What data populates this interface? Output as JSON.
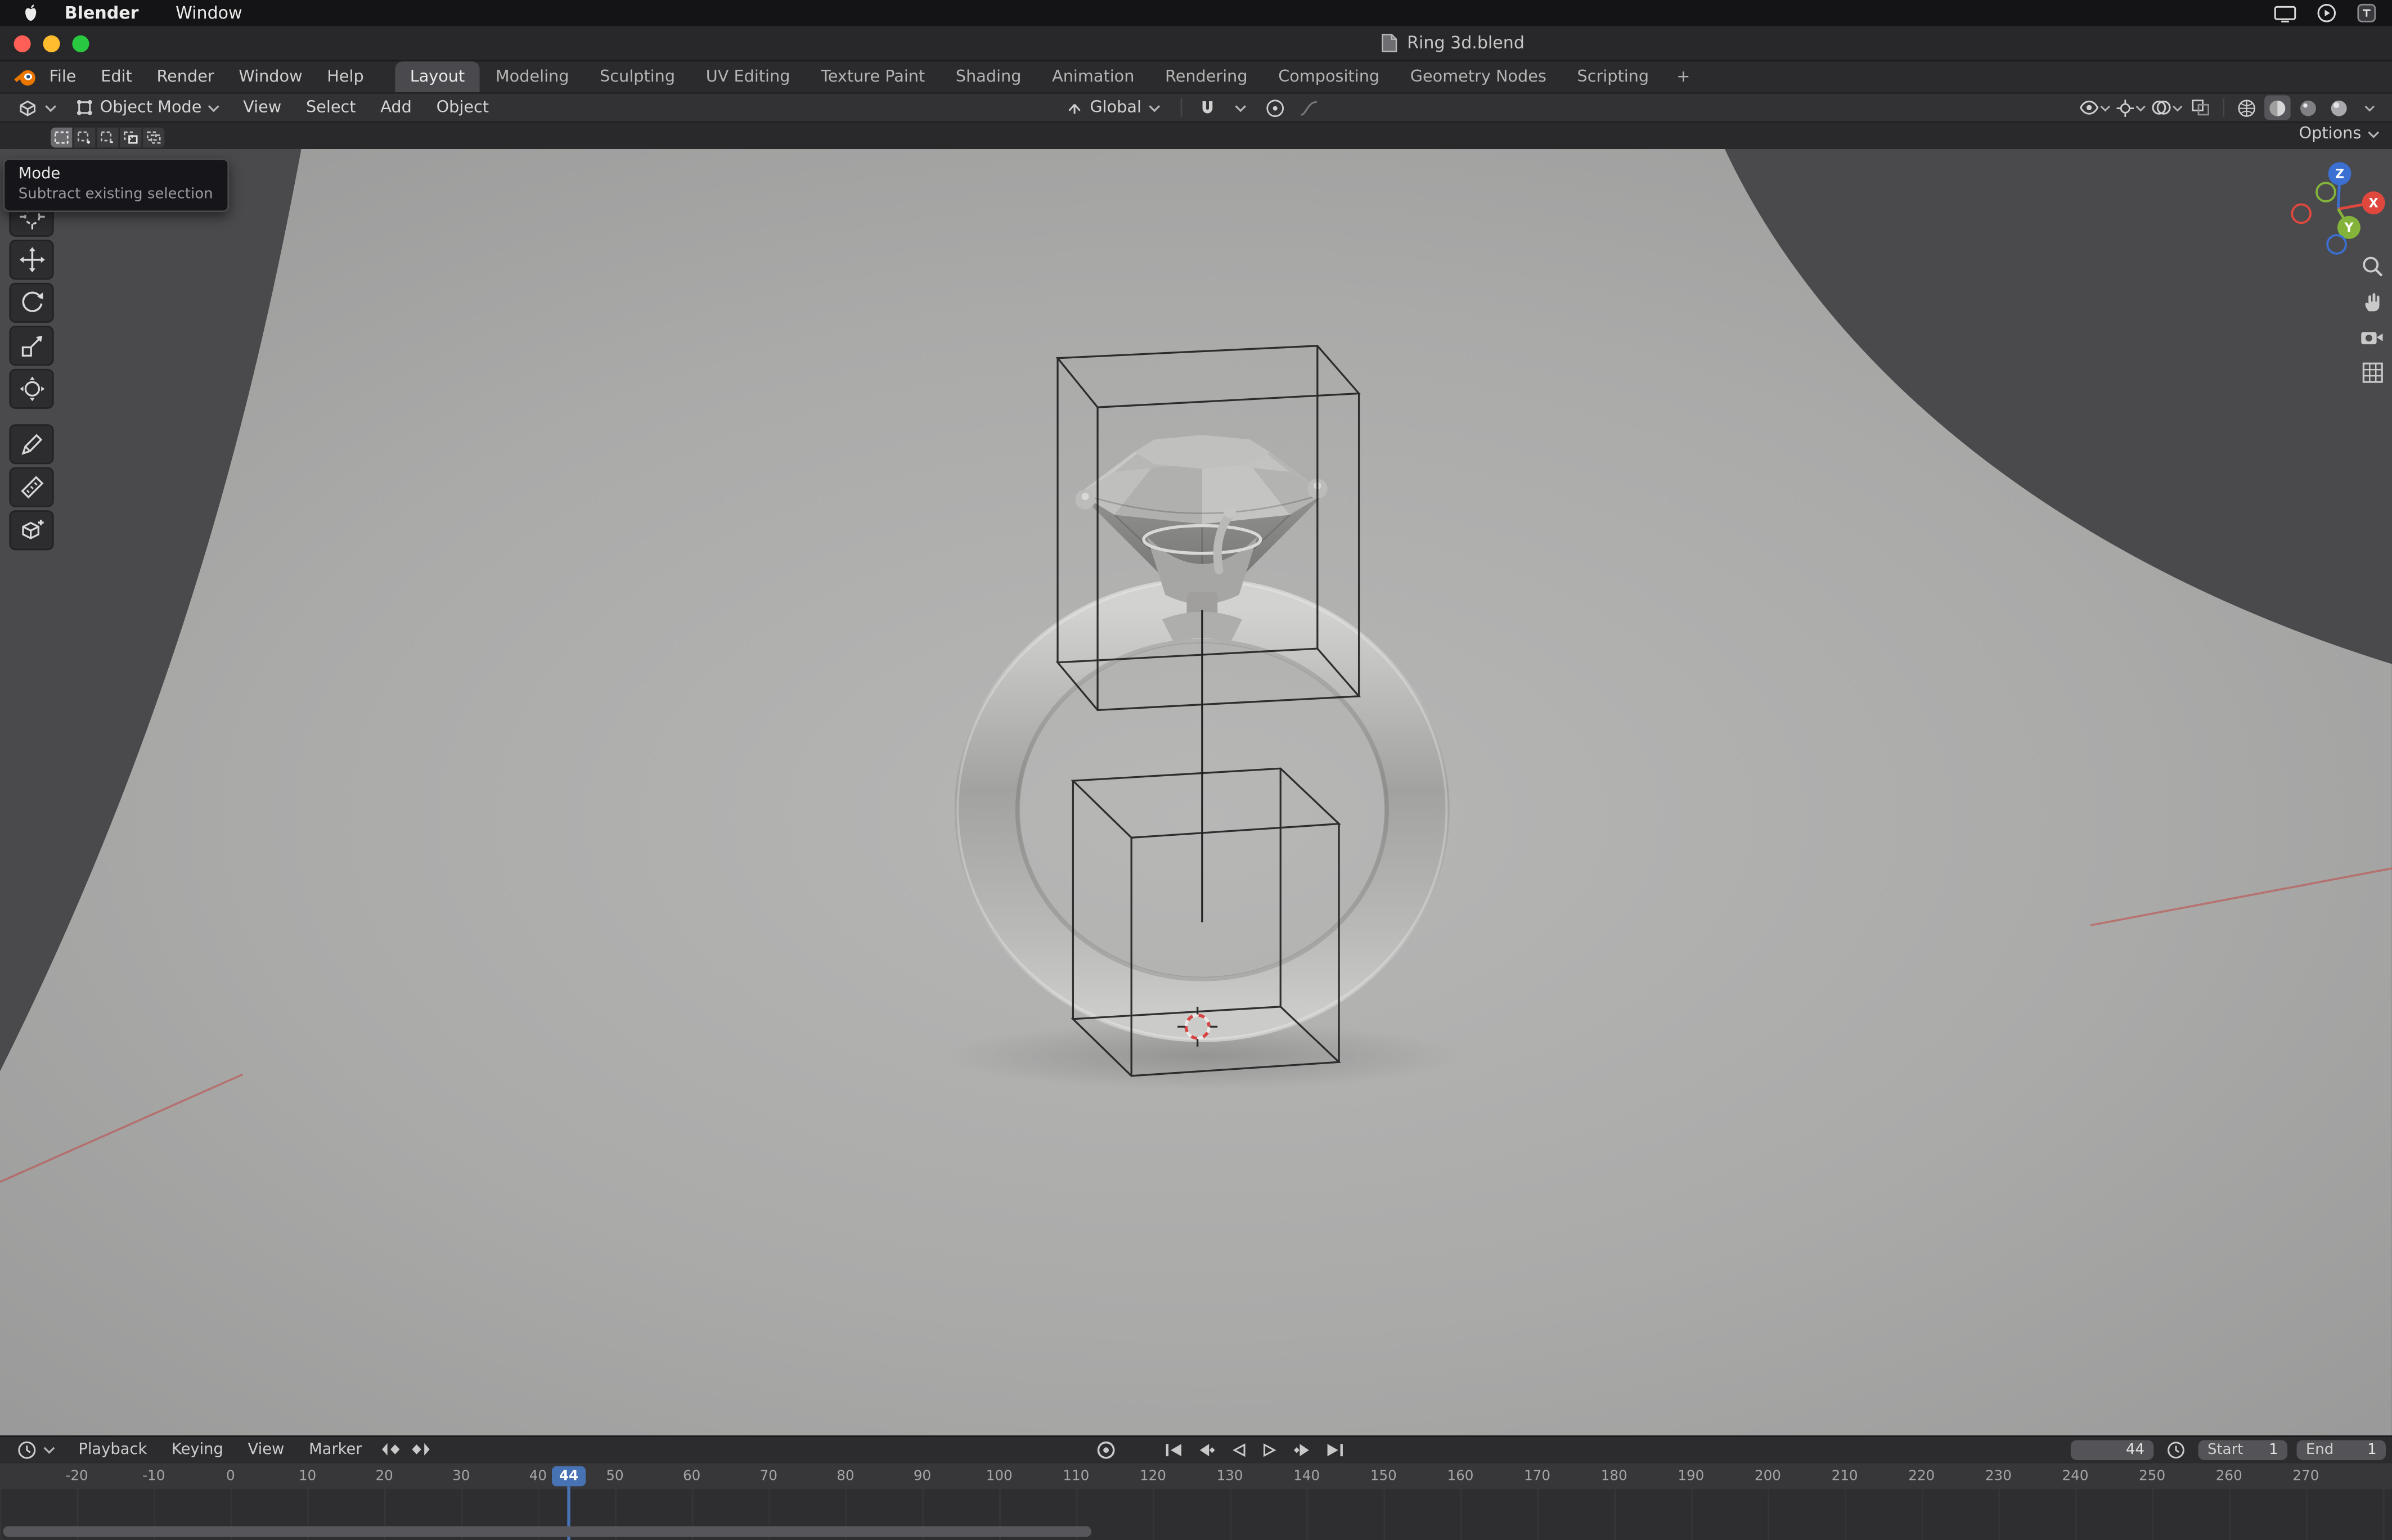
{
  "colors": {
    "accent": "#4772b3",
    "axis_x": "#e0483e",
    "axis_y": "#84b33b",
    "axis_z": "#3b6fd1"
  },
  "macos_menubar": {
    "app_menu": "Blender",
    "window_menu": "Window"
  },
  "titlebar": {
    "filename": "Ring 3d.blend"
  },
  "topbar": {
    "menus": [
      "File",
      "Edit",
      "Render",
      "Window",
      "Help"
    ],
    "workspaces": [
      "Layout",
      "Modeling",
      "Sculpting",
      "UV Editing",
      "Texture Paint",
      "Shading",
      "Animation",
      "Rendering",
      "Compositing",
      "Geometry Nodes",
      "Scripting"
    ],
    "active_workspace": "Layout",
    "add_tab": "+"
  },
  "viewport": {
    "header": {
      "mode": "Object Mode",
      "menus": [
        "View",
        "Select",
        "Add",
        "Object"
      ],
      "orientation": "Global"
    },
    "tool_settings": {
      "options": "Options"
    },
    "tooltip": {
      "title": "Mode",
      "description": "Subtract existing selection"
    },
    "toolbar_tools": [
      "select-cursor",
      "move",
      "rotate",
      "scale",
      "transform",
      "annotate",
      "measure",
      "add-cube"
    ],
    "nav_icons": [
      "zoom",
      "pan",
      "camera-view",
      "toggle-orthographic"
    ],
    "gizmo_axes": [
      "X",
      "Y",
      "Z"
    ]
  },
  "timeline": {
    "menus": [
      "Playback",
      "Keying",
      "View",
      "Marker"
    ],
    "current_frame": "44",
    "start": {
      "label": "Start",
      "value": "1"
    },
    "end": {
      "label": "End",
      "value": "1"
    },
    "ruler_ticks": [
      "-20",
      "-10",
      "0",
      "10",
      "20",
      "30",
      "40",
      "50",
      "60",
      "70",
      "80",
      "90",
      "100",
      "110",
      "120",
      "130",
      "140",
      "150",
      "160",
      "170",
      "180",
      "190",
      "200",
      "210",
      "220",
      "230",
      "240",
      "250",
      "260",
      "270"
    ]
  }
}
